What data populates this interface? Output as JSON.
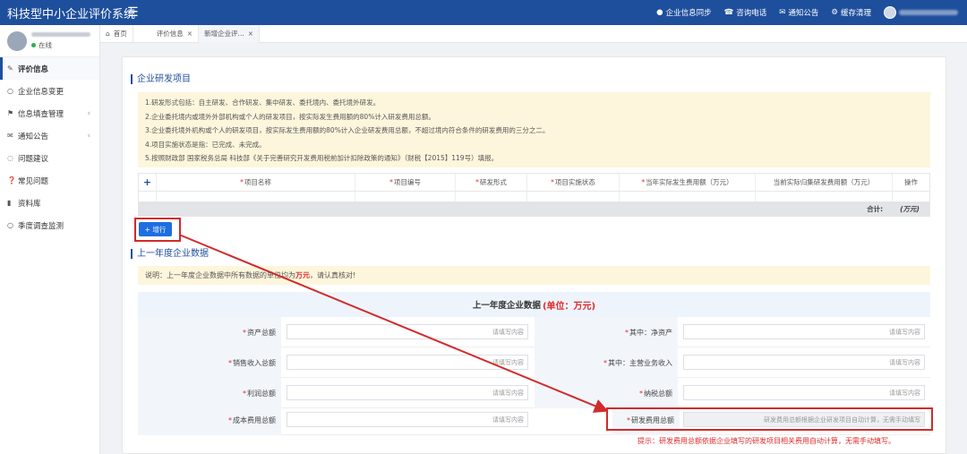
{
  "header": {
    "app_title": "科技型中小企业评价系统",
    "actions": [
      "企业信息同步",
      "咨询电话",
      "通知公告",
      "缓存清理"
    ]
  },
  "sidebar": {
    "status": "在线",
    "items": [
      {
        "label": "评价信息",
        "icon": "edit-icon",
        "active": true
      },
      {
        "label": "企业信息变更",
        "icon": "circle-icon"
      },
      {
        "label": "信息填查管理",
        "icon": "tag-icon",
        "chevron": "‹"
      },
      {
        "label": "通知公告",
        "icon": "bell-icon",
        "chevron": "‹"
      },
      {
        "label": "问题建议",
        "icon": "chat-icon"
      },
      {
        "label": "常见问题",
        "icon": "question-icon"
      },
      {
        "label": "资料库",
        "icon": "folder-icon"
      },
      {
        "label": "季度调查监测",
        "icon": "circle-icon"
      }
    ]
  },
  "tabs": [
    {
      "label": "首页",
      "icon": "home-icon"
    },
    {
      "label": "评价信息",
      "close": "×"
    },
    {
      "label": "新增企业评...",
      "close": "×"
    }
  ],
  "section1": {
    "title": "企业研发项目"
  },
  "notes": [
    "1.研发形式包括：自主研发、合作研发、集中研发、委托境内、委托境外研发。",
    "2.企业委托境内或境外外部机构或个人的研发项目，按实际发生费用额的80%计入研发费用总额。",
    "3.企业委托境外机构或个人的研发项目，按实际发生费用额的80%计入企业研发费用总额，不超过境内符合条件的研发费用的三分之二。",
    "4.项目实施状态是指：已完成、未完成。",
    "5.按照财政部 国家税务总局 科技部《关于完善研究开发费用税前加计扣除政策的通知》（财税【2015】119号）填报。"
  ],
  "table": {
    "add_symbol": "+",
    "headers": [
      "项目名称",
      "项目编号",
      "研发形式",
      "项目实施状态",
      "当年实际发生费用额（万元）",
      "当前实际归集研发费用额（万元）",
      "操作"
    ],
    "total_label": "合计:",
    "total_unit": "(万元)"
  },
  "add_row_button": "+ 增行",
  "section2": {
    "title": "上一年度企业数据"
  },
  "note2": {
    "prefix": "说明：上一年度企业数据中所有数据的单位均为",
    "unit": "万元",
    "suffix": "，请认真核对!"
  },
  "form": {
    "title": "上一年度企业数据",
    "title_unit": "(单位：万元)",
    "placeholder": "请填写内容",
    "rows": [
      {
        "left": "资产总额",
        "right": "其中：净资产"
      },
      {
        "left": "销售收入总额",
        "right": "其中：主营业务收入"
      },
      {
        "left": "利润总额",
        "right": "纳税总额"
      },
      {
        "left": "成本费用总额",
        "right": "研发费用总额"
      }
    ],
    "rd_auto_text": "研发费用总额根据企业研发项目自动计算，无需手动填写"
  },
  "tip": "提示：研发费用总额依据企业填写的研发项目相关费用自动计算，无需手动填写。"
}
